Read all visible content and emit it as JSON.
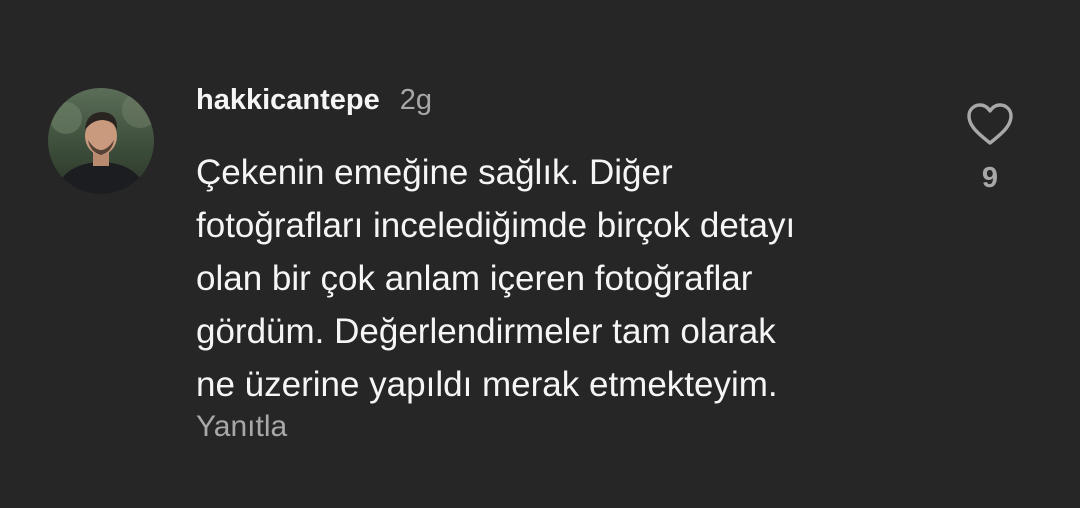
{
  "comment": {
    "username": "hakkicantepe",
    "timestamp": "2g",
    "text": "Çekenin emeğine sağlık. Diğer\nfotoğrafları incelediğimde birçok detayı\nolan bir çok anlam içeren fotoğraflar\ngördüm. Değerlendirmeler tam olarak\nne üzerine yapıldı merak etmekteyim.",
    "reply_label": "Yanıtla",
    "like_count": "9"
  },
  "icons": {
    "like": "heart-outline-icon",
    "avatar": "user-profile-photo"
  },
  "colors": {
    "background": "#262626",
    "primary_text": "#f5f5f5",
    "secondary_text": "#a8a8a8"
  }
}
